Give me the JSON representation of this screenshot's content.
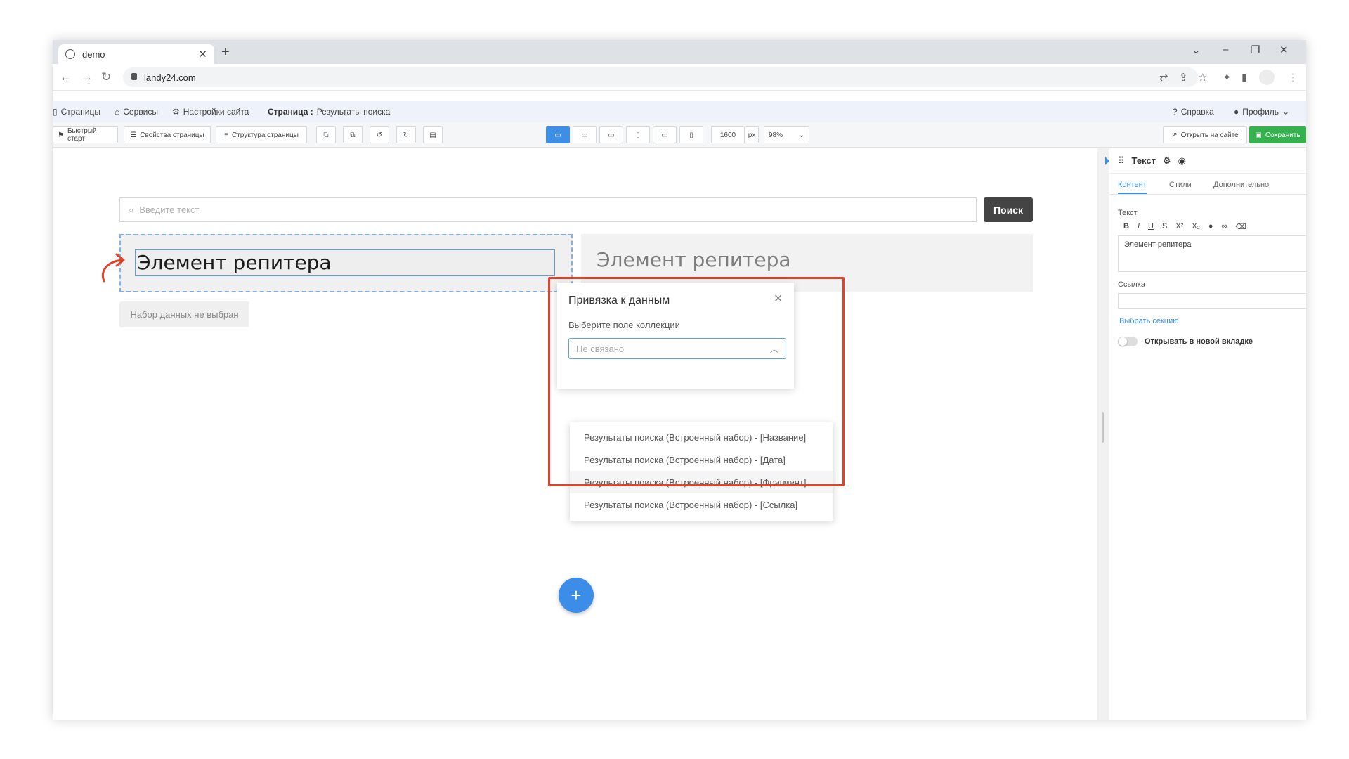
{
  "browser": {
    "tab_title": "demo",
    "tab_close": "✕",
    "new_tab": "+",
    "url": "landy24.com",
    "window_controls": [
      "⌄",
      "–",
      "❐",
      "✕"
    ],
    "extension_icons": [
      "translate-icon",
      "share-icon",
      "star-icon",
      "puzzle-icon",
      "sidepanel-icon",
      "profile-icon",
      "menu-icon"
    ]
  },
  "app_menu": {
    "pages": "Страницы",
    "services": "Сервисы",
    "site_settings": "Настройки сайта",
    "page_label": "Страница :",
    "page_name": "Результаты поиска",
    "help": "Справка",
    "profile": "Профиль"
  },
  "toolbar": {
    "quick_start": "Быстрый старт",
    "page_props": "Свойства страницы",
    "page_structure": "Структура страницы",
    "width_value": "1600",
    "width_unit": "px",
    "zoom": "98%",
    "open_on_site": "Открыть на сайте",
    "save": "Сохранить"
  },
  "canvas": {
    "search_placeholder": "Введите текст",
    "search_button": "Поиск",
    "repeater_left": "Элемент репитера",
    "repeater_right": "Элемент репитера",
    "no_dataset": "Набор данных не выбран",
    "add_button": "+"
  },
  "binding_popover": {
    "title": "Привязка к данным",
    "close": "✕",
    "field_label": "Выберите поле коллекции",
    "select_value": "Не связано",
    "options": [
      "Результаты поиска (Встроенный набор) - [Название]",
      "Результаты поиска (Встроенный набор) - [Дата]",
      "Результаты поиска (Встроенный набор) - [Фрагмент]",
      "Результаты поиска (Встроенный набор) - [Ссылка]"
    ],
    "hovered_index": 2
  },
  "panel": {
    "title": "Текст",
    "tabs": [
      "Контент",
      "Стили",
      "Дополнительно"
    ],
    "active_tab": "Контент",
    "text_label": "Текст",
    "format_buttons": [
      "B",
      "I",
      "U",
      "S",
      "X²",
      "X₂",
      "●",
      "∞",
      "⌫"
    ],
    "text_value": "Элемент репитера",
    "link_label": "Ссылка",
    "link_value": "",
    "pick_section": "Выбрать секцию",
    "new_tab_toggle": "Открывать в новой вкладке",
    "new_tab_enabled": false
  },
  "colors": {
    "accent": "#3d8fe5",
    "save_green": "#35b14e",
    "highlight_red": "#e4412b",
    "search_button": "#444444"
  }
}
